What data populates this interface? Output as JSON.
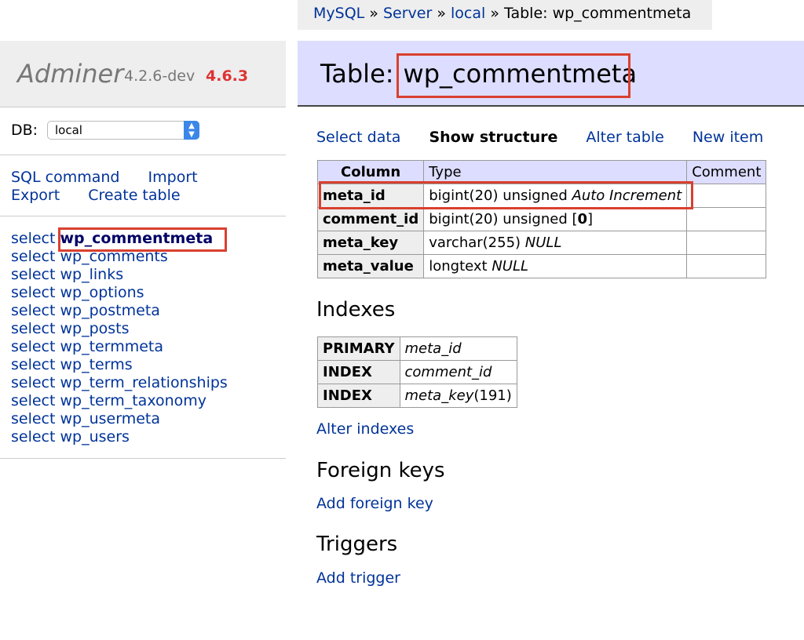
{
  "breadcrumb": {
    "items": [
      "MySQL",
      "Server",
      "local"
    ],
    "separator": "»",
    "current": "Table: wp_commentmeta"
  },
  "sidebar": {
    "app_name": "Adminer",
    "version": "4.2.6-dev",
    "new_version": "4.6.3",
    "db_label": "DB:",
    "db_value": "local",
    "links": {
      "sql_command": "SQL command",
      "import": "Import",
      "export": "Export",
      "create_table": "Create table"
    },
    "select_prefix": "select",
    "tables": [
      "wp_commentmeta",
      "wp_comments",
      "wp_links",
      "wp_options",
      "wp_postmeta",
      "wp_posts",
      "wp_termmeta",
      "wp_terms",
      "wp_term_relationships",
      "wp_term_taxonomy",
      "wp_usermeta",
      "wp_users"
    ],
    "active_table": "wp_commentmeta"
  },
  "main": {
    "title_prefix": "Table:",
    "title_table": "wp_commentmeta",
    "actions": {
      "select_data": "Select data",
      "show_structure": "Show structure",
      "alter_table": "Alter table",
      "new_item": "New item"
    },
    "structure": {
      "headers": [
        "Column",
        "Type",
        "Comment"
      ],
      "rows": [
        {
          "column": "meta_id",
          "type": "bigint(20) unsigned",
          "type_extra": "Auto Increment",
          "comment": ""
        },
        {
          "column": "comment_id",
          "type": "bigint(20) unsigned [",
          "type_default": "0",
          "type_close": "]",
          "comment": ""
        },
        {
          "column": "meta_key",
          "type": "varchar(255)",
          "type_extra": "NULL",
          "comment": ""
        },
        {
          "column": "meta_value",
          "type": "longtext",
          "type_extra": "NULL",
          "comment": ""
        }
      ]
    },
    "indexes": {
      "title": "Indexes",
      "rows": [
        {
          "kind": "PRIMARY",
          "column": "meta_id",
          "suffix": ""
        },
        {
          "kind": "INDEX",
          "column": "comment_id",
          "suffix": ""
        },
        {
          "kind": "INDEX",
          "column": "meta_key",
          "suffix": "(191)"
        }
      ],
      "alter_link": "Alter indexes"
    },
    "foreign_keys": {
      "title": "Foreign keys",
      "add_link": "Add foreign key"
    },
    "triggers": {
      "title": "Triggers",
      "add_link": "Add trigger"
    }
  },
  "colors": {
    "link": "#003399",
    "highlight_box": "#d9402f",
    "header_bg": "#ddddff",
    "new_version": "#dd3333"
  }
}
